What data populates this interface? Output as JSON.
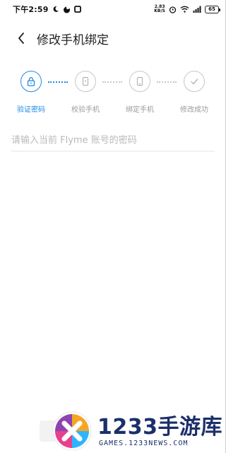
{
  "status_bar": {
    "time": "下午2:59",
    "netspeed_value": "2.83",
    "netspeed_unit": "KB/S",
    "battery": "65",
    "left_icons": [
      "moon-icon",
      "app-notification-icon",
      "square-notification-icon"
    ],
    "right_icons": [
      "alarm-icon",
      "wifi-icon",
      "signal-icon",
      "battery-icon"
    ]
  },
  "header": {
    "title": "修改手机绑定",
    "back_icon": "chevron-left-icon"
  },
  "stepper": {
    "steps": [
      {
        "label": "验证密码",
        "icon": "lock-icon",
        "active": true
      },
      {
        "label": "校验手机",
        "icon": "phone-check-icon",
        "active": false
      },
      {
        "label": "绑定手机",
        "icon": "phone-icon",
        "active": false
      },
      {
        "label": "修改成功",
        "icon": "check-icon",
        "active": false
      }
    ],
    "accent_color": "#1e88e5",
    "inactive_color": "#c7c7c7"
  },
  "form": {
    "password_placeholder": "请输入当前 Flyme 账号的密码",
    "password_value": ""
  },
  "watermark": {
    "title": "1233手游库",
    "subtitle": "GAMES.1233NEWS.COM"
  }
}
